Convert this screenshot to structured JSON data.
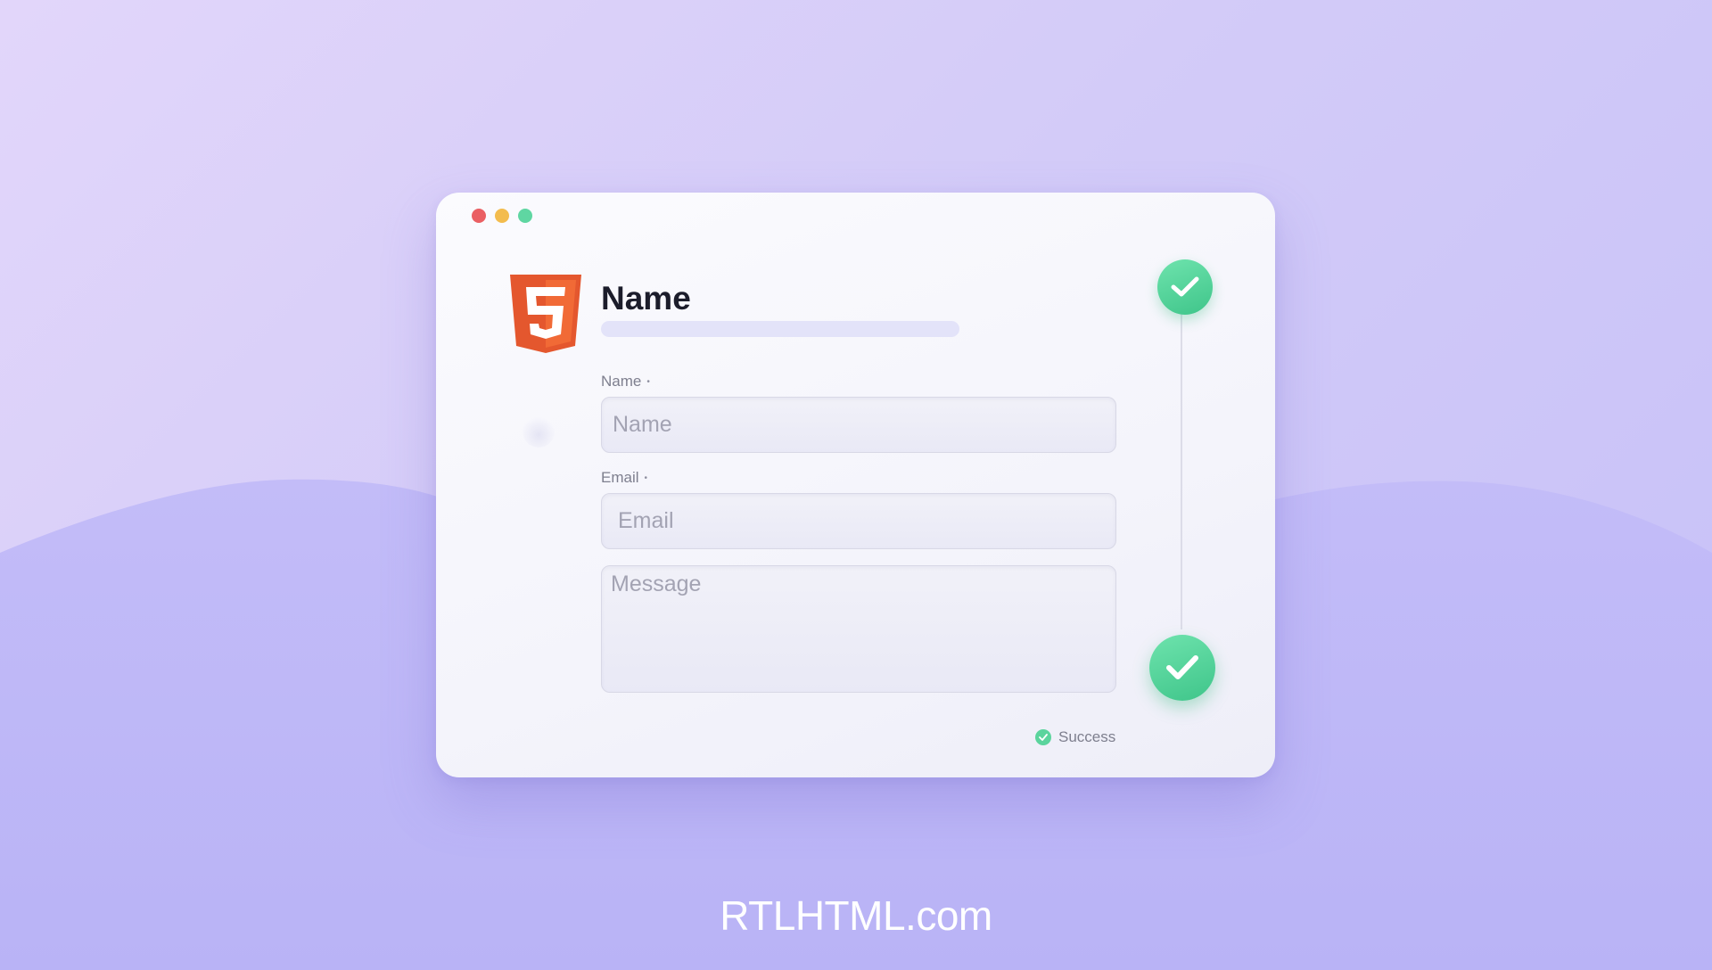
{
  "window": {
    "heading": "Name",
    "traffic_lights": [
      "close",
      "minimize",
      "maximize"
    ]
  },
  "form": {
    "name": {
      "label": "Name",
      "required_mark": "•",
      "placeholder": "Name"
    },
    "email": {
      "label": "Email",
      "required_mark": "•",
      "placeholder": "Email"
    },
    "message": {
      "placeholder": "Message"
    }
  },
  "status": {
    "text": "Success"
  },
  "footer": {
    "brand": "RTLHTML.com"
  },
  "icons": {
    "logo": "html5-logo",
    "step_done": "check-icon",
    "status": "check-icon"
  },
  "colors": {
    "accent_green": "#4fce96",
    "html5_orange": "#e4572e",
    "background": "#d3cbf8"
  }
}
